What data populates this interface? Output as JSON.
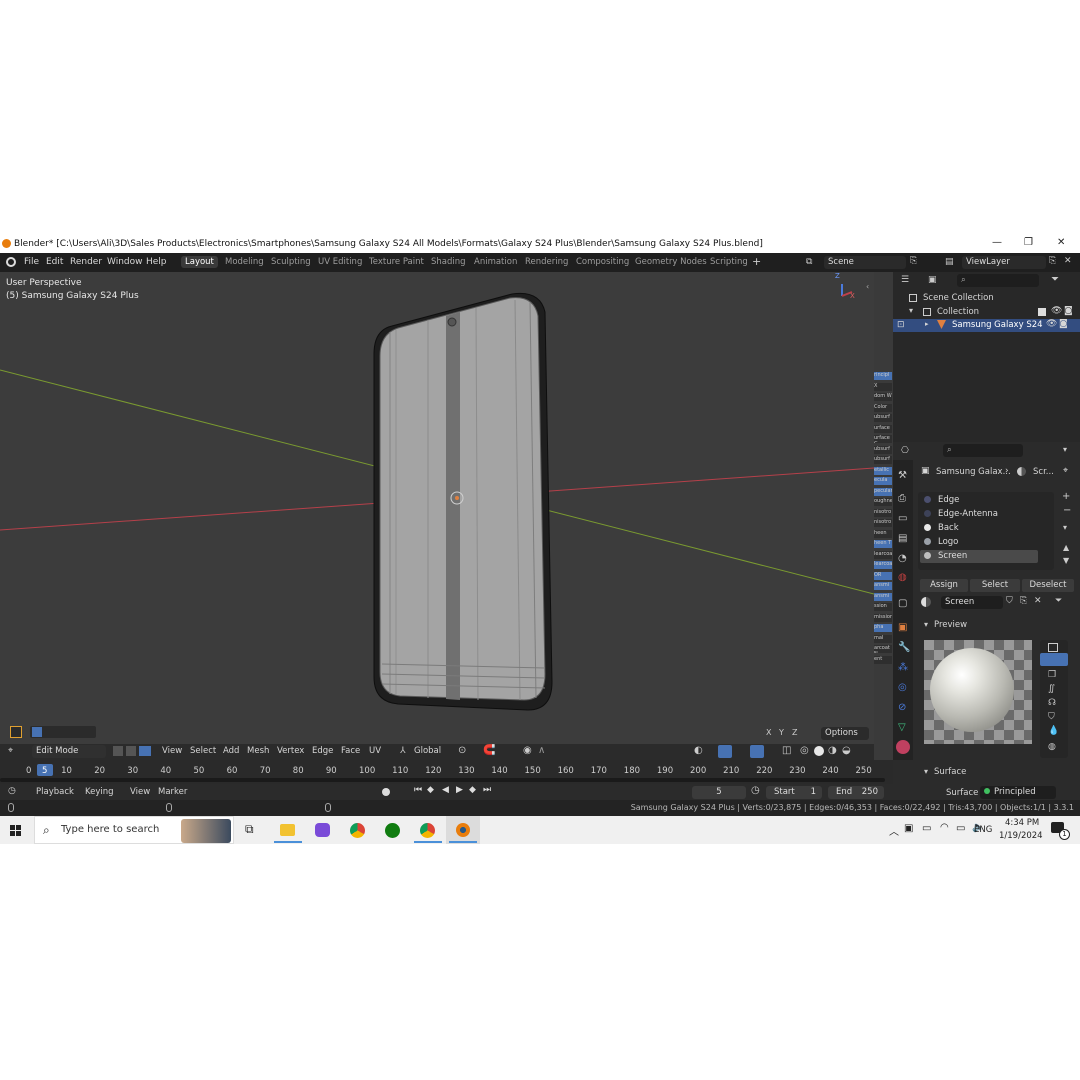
{
  "window": {
    "title": "Blender* [C:\\Users\\Ali\\3D\\Sales Products\\Electronics\\Smartphones\\Samsung Galaxy S24 All Models\\Formats\\Galaxy S24 Plus\\Blender\\Samsung Galaxy S24 Plus.blend]",
    "controls": [
      "—",
      "❐",
      "✕"
    ]
  },
  "menubar": {
    "menus": [
      "File",
      "Edit",
      "Render",
      "Window",
      "Help"
    ],
    "workspaces": [
      "Layout",
      "Modeling",
      "Sculpting",
      "UV Editing",
      "Texture Paint",
      "Shading",
      "Animation",
      "Rendering",
      "Compositing",
      "Geometry Nodes",
      "Scripting"
    ],
    "active_workspace": "Layout",
    "add_tab": "+",
    "scene": "Scene",
    "view_layer": "ViewLayer"
  },
  "viewport": {
    "perspective": "User Perspective",
    "object_label": "(5) Samsung Galaxy S24 Plus",
    "axis_x": "X",
    "axis_z": "Z",
    "axis_y": "Y",
    "options_label": "Options",
    "xyz": [
      "X",
      "Y",
      "Z"
    ]
  },
  "viewport_header": {
    "mode": "Edit Mode",
    "menus": [
      "View",
      "Select",
      "Add",
      "Mesh",
      "Vertex",
      "Edge",
      "Face",
      "UV"
    ],
    "transform": "Global"
  },
  "outliner": {
    "items": [
      {
        "label": "Scene Collection",
        "level": 0
      },
      {
        "label": "Collection",
        "level": 1
      },
      {
        "label": "Samsung Galaxy S24",
        "level": 2,
        "selected": true
      }
    ]
  },
  "properties": {
    "breadcrumb_object": "Samsung Galax...",
    "breadcrumb_material": "Scr...",
    "materials": [
      {
        "name": "Edge",
        "color": "#4b4f6e"
      },
      {
        "name": "Edge-Antenna",
        "color": "#3d4258"
      },
      {
        "name": "Back",
        "color": "#e8e8e8"
      },
      {
        "name": "Logo",
        "color": "#9aa0a8"
      },
      {
        "name": "Screen",
        "color": "#bfbfbf"
      }
    ],
    "selected_material": "Screen",
    "assign": "Assign",
    "select": "Select",
    "deselect": "Deselect",
    "material_name": "Screen",
    "preview_label": "Preview",
    "surface_section": "Surface",
    "surface_label": "Surface",
    "surface_value": "Principled BSDF"
  },
  "node_strip": [
    "rincipl",
    "X",
    "dom W",
    "Color",
    "ubsurf",
    "urface",
    "urface C",
    "ubsurf",
    "ubsurf",
    "etallic",
    "ecula",
    "pecular",
    "oughne",
    "nisotro",
    "nisotro",
    "heen",
    "heen T",
    "learcoa",
    "learcoa",
    "OR",
    "ansmi",
    "ansmi",
    "ssion",
    "mission",
    "pha",
    "mal",
    "arcoat N",
    "ent"
  ],
  "timeline": {
    "frames": [
      "0",
      "5",
      "10",
      "20",
      "30",
      "40",
      "50",
      "60",
      "70",
      "80",
      "90",
      "100",
      "110",
      "120",
      "130",
      "140",
      "150",
      "160",
      "170",
      "180",
      "190",
      "200",
      "210",
      "220",
      "230",
      "240",
      "250"
    ],
    "current_frame": "5",
    "menus": [
      "Playback",
      "Keying",
      "View",
      "Marker"
    ],
    "current": "5",
    "start_label": "Start",
    "start": "1",
    "end_label": "End",
    "end": "250"
  },
  "status": {
    "text": "Samsung Galaxy S24 Plus | Verts:0/23,875 | Edges:0/46,353 | Faces:0/22,492 | Tris:43,700 | Objects:1/1 | 3.3.1"
  },
  "taskbar": {
    "search_placeholder": "Type here to search",
    "lang": "ENG",
    "time": "4:34 PM",
    "date": "1/19/2024",
    "notif": "1"
  },
  "colors": {
    "accent": "#4772b3",
    "viewport_bg": "#3c3c3c",
    "x_axis": "#c0404a",
    "y_axis": "#7a9a30",
    "selection": "#334d80"
  }
}
